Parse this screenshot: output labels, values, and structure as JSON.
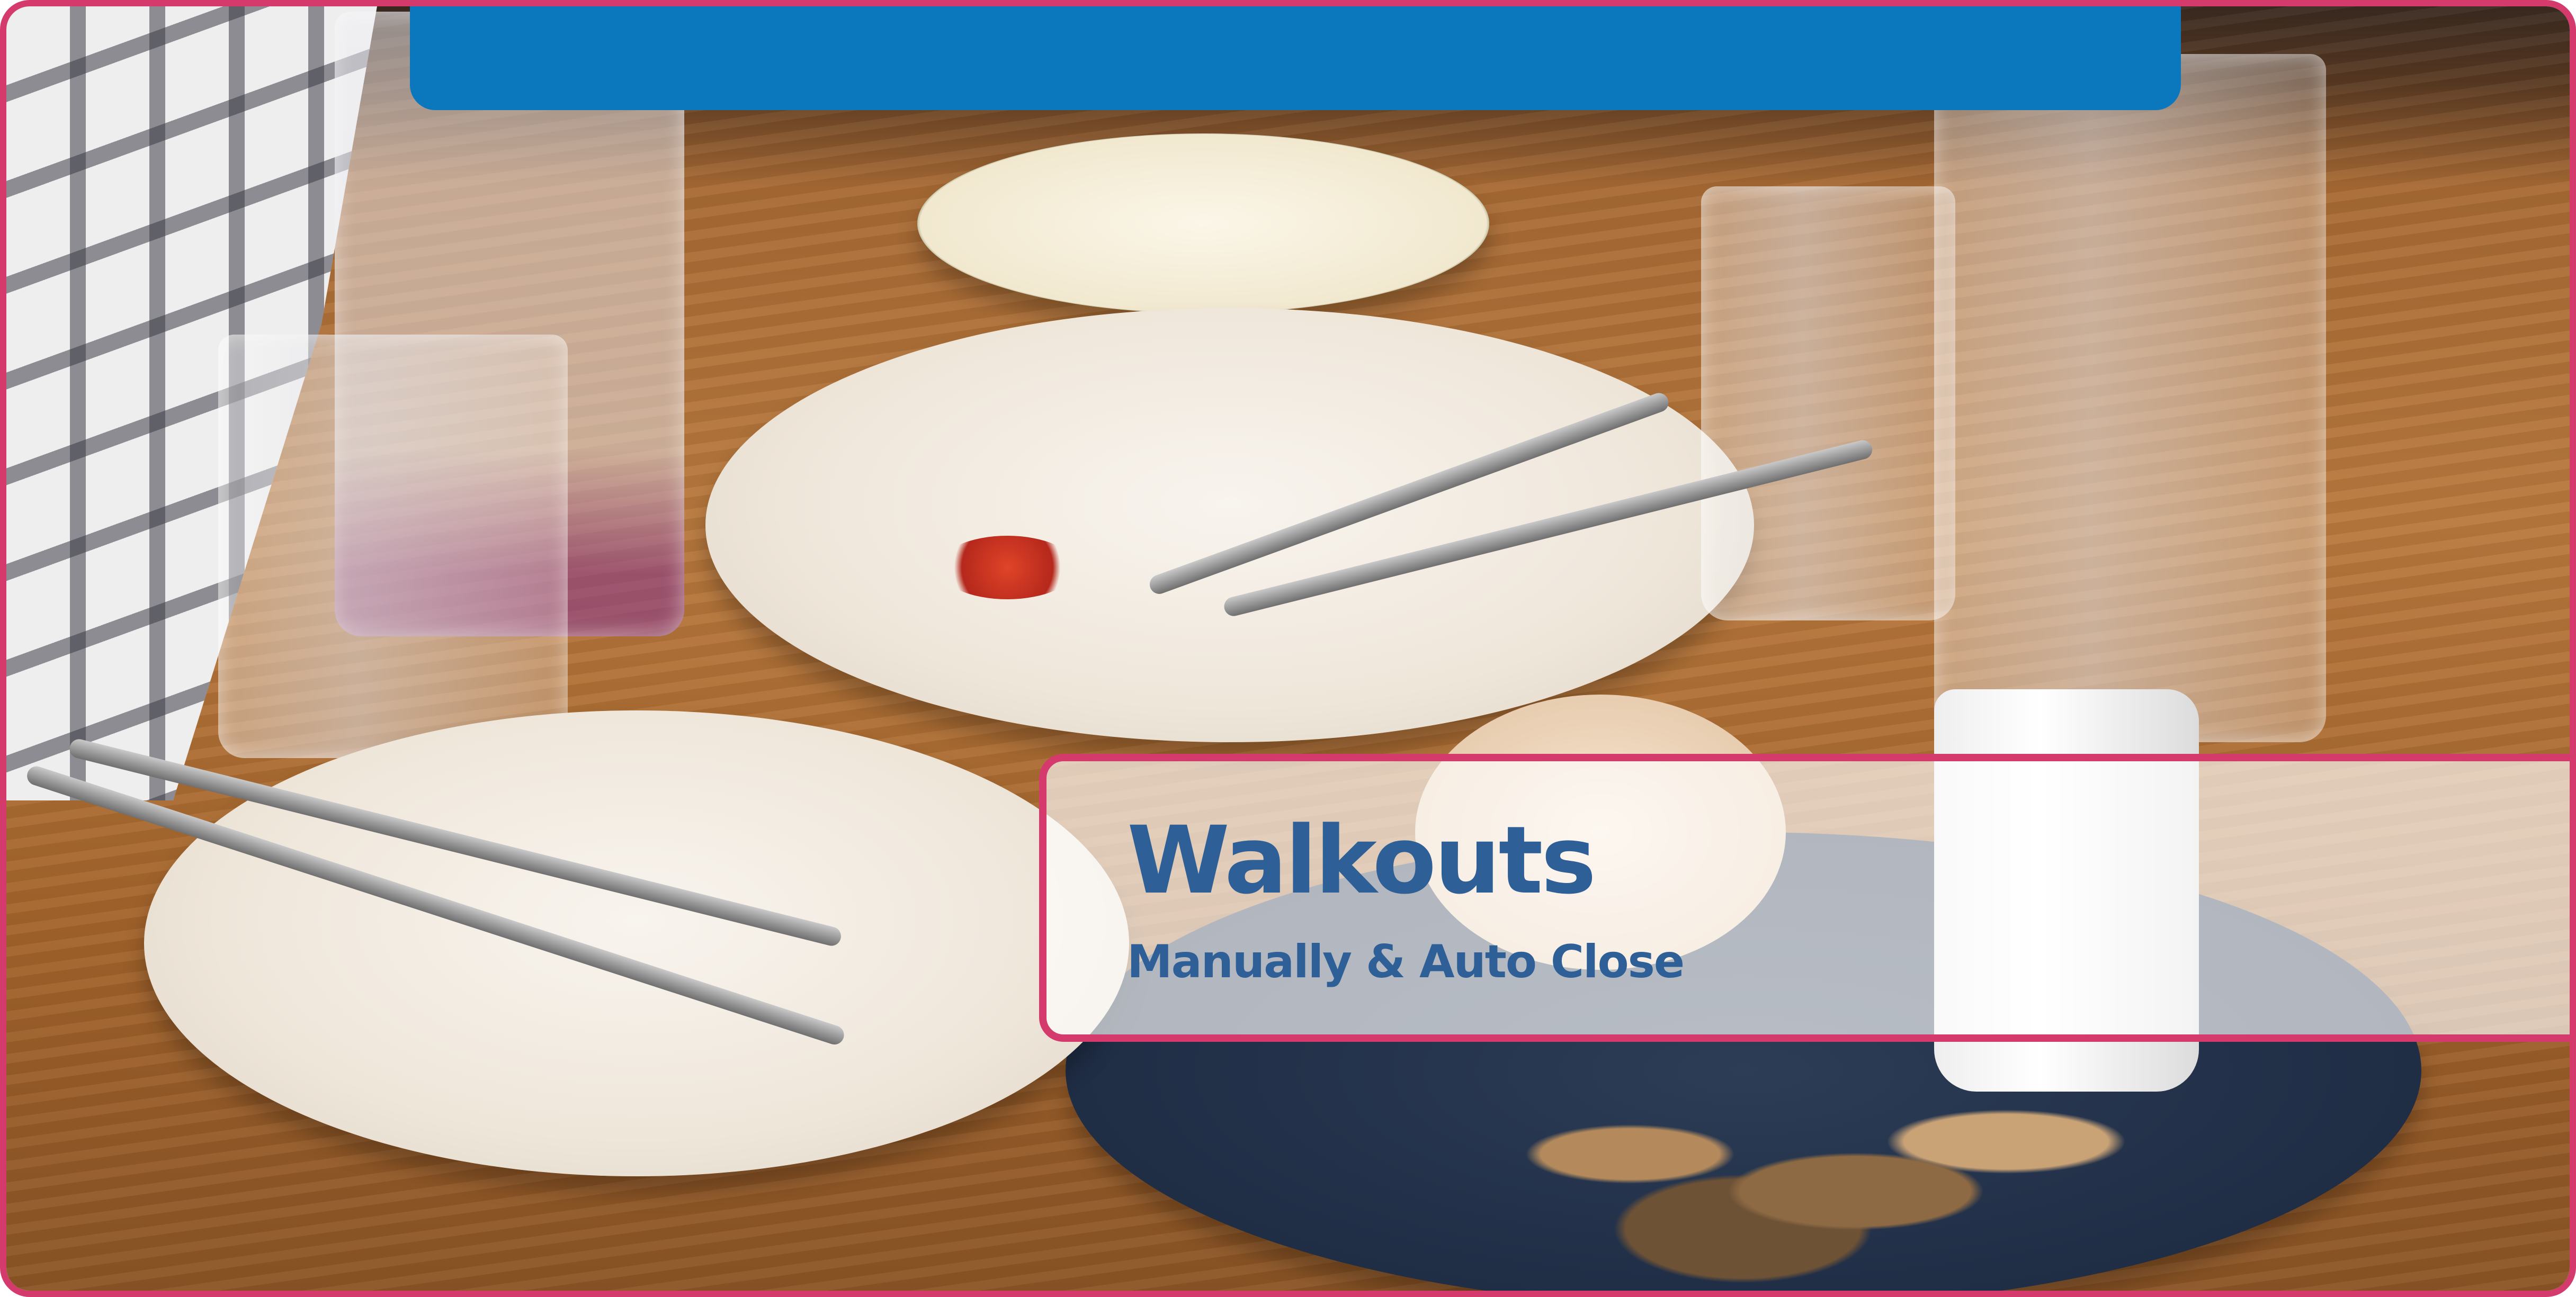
{
  "title": "Walkouts",
  "subtitle": "Manually & Auto Close",
  "colors": {
    "frame_border": "#d53a6c",
    "top_bar": "#0b77bd",
    "title_text": "#2f5f97"
  }
}
